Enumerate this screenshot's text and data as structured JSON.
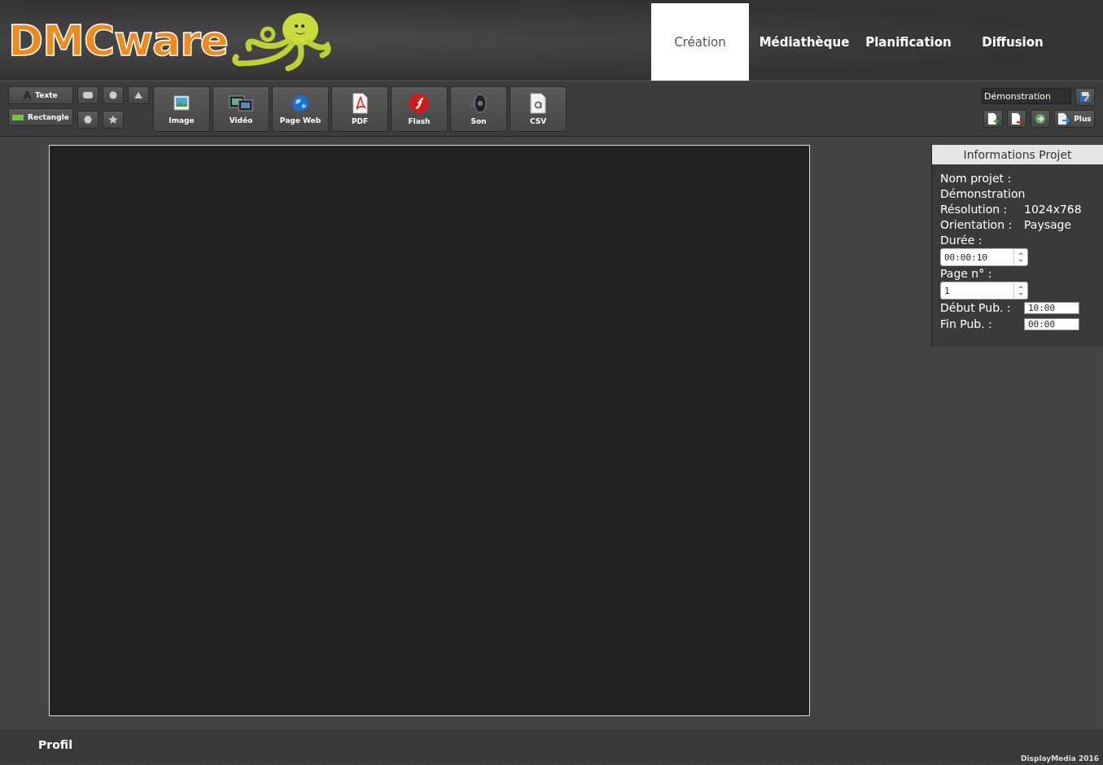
{
  "logo": {
    "text": "DMCware"
  },
  "tabs": [
    {
      "label": "Création",
      "selected": true
    },
    {
      "label": "Médiathèque",
      "selected": false
    },
    {
      "label": "Planification",
      "selected": false
    },
    {
      "label": "Diffusion",
      "selected": false
    }
  ],
  "toolbar": {
    "text_tools": [
      {
        "kind": "text",
        "label": "Texte"
      },
      {
        "kind": "rectangle",
        "label": "Rectangle"
      }
    ],
    "shape_tools": [
      {
        "kind": "rounded"
      },
      {
        "kind": "circle"
      },
      {
        "kind": "triangle"
      },
      {
        "kind": "hexagon"
      },
      {
        "kind": "star"
      }
    ],
    "media_buttons": [
      {
        "kind": "image",
        "label": "Image"
      },
      {
        "kind": "video",
        "label": "Vidéo"
      },
      {
        "kind": "web",
        "label": "Page Web"
      },
      {
        "kind": "pdf",
        "label": "PDF"
      },
      {
        "kind": "flash",
        "label": "Flash"
      },
      {
        "kind": "sound",
        "label": "Son"
      },
      {
        "kind": "csv",
        "label": "CSV"
      }
    ],
    "project_name": {
      "value": "Démonstration"
    },
    "actions": [
      {
        "kind": "add"
      },
      {
        "kind": "remove"
      },
      {
        "kind": "go"
      },
      {
        "kind": "more",
        "label": "Plus"
      }
    ]
  },
  "info_panel": {
    "title": "Informations Projet",
    "name_label": "Nom projet :",
    "name_value": "Démonstration",
    "rows": [
      {
        "label": "Résolution :",
        "value": "1024x768"
      },
      {
        "label": "Orientation :",
        "value": "Paysage"
      }
    ],
    "duration_label": "Durée :",
    "duration_value": "00:00:10",
    "page_label": "Page n° :",
    "page_value": "1",
    "times": [
      {
        "label": "Début Pub. :",
        "value": "10:00"
      },
      {
        "label": "Fin Pub. :",
        "value": "00:00"
      }
    ]
  },
  "footer": {
    "link": "Profil",
    "copyright": "DisplayMedia 2016"
  }
}
